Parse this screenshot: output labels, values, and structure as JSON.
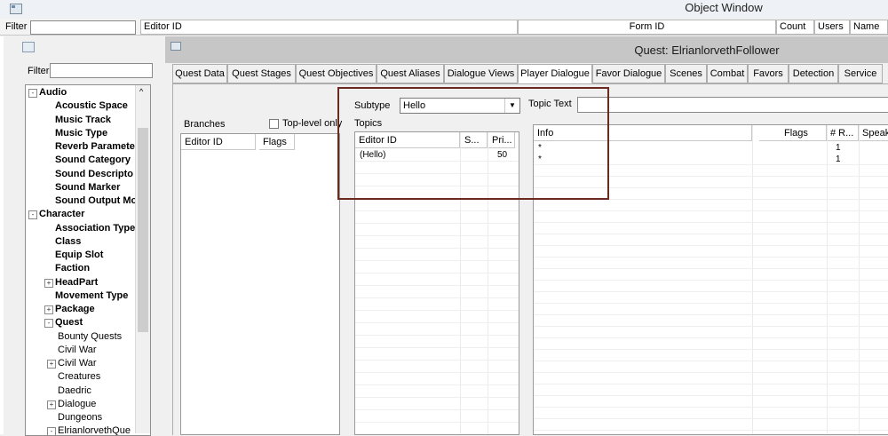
{
  "window": {
    "title": "Object Window"
  },
  "top_bar": {
    "filter_label": "Filter",
    "filter_value": "",
    "columns": [
      "Editor ID",
      "Form ID",
      "Count",
      "Users",
      "Name"
    ]
  },
  "left_pane": {
    "filter_label": "Filter",
    "filter_value": "",
    "tree": [
      {
        "label": "Audio",
        "level": 0,
        "bold": true,
        "expander": "-"
      },
      {
        "label": "Acoustic Space",
        "level": 1,
        "bold": true
      },
      {
        "label": "Music Track",
        "level": 1,
        "bold": true
      },
      {
        "label": "Music Type",
        "level": 1,
        "bold": true
      },
      {
        "label": "Reverb Paramete",
        "level": 1,
        "bold": true
      },
      {
        "label": "Sound Category",
        "level": 1,
        "bold": true
      },
      {
        "label": "Sound Descripto",
        "level": 1,
        "bold": true
      },
      {
        "label": "Sound Marker",
        "level": 1,
        "bold": true
      },
      {
        "label": "Sound Output Mo",
        "level": 1,
        "bold": true
      },
      {
        "label": "Character",
        "level": 0,
        "bold": true,
        "expander": "-"
      },
      {
        "label": "Association Type",
        "level": 1,
        "bold": true
      },
      {
        "label": "Class",
        "level": 1,
        "bold": true
      },
      {
        "label": "Equip Slot",
        "level": 1,
        "bold": true
      },
      {
        "label": "Faction",
        "level": 1,
        "bold": true
      },
      {
        "label": "HeadPart",
        "level": 1,
        "bold": true,
        "expander": "+"
      },
      {
        "label": "Movement Type",
        "level": 1,
        "bold": true
      },
      {
        "label": "Package",
        "level": 1,
        "bold": true,
        "expander": "+"
      },
      {
        "label": "Quest",
        "level": 1,
        "bold": true,
        "expander": "-"
      },
      {
        "label": "Bounty Quests",
        "level": 2,
        "bold": false
      },
      {
        "label": "Civil War",
        "level": 2,
        "bold": false
      },
      {
        "label": "Civil War",
        "level": 2,
        "bold": false,
        "expander": "+"
      },
      {
        "label": "Creatures",
        "level": 2,
        "bold": false
      },
      {
        "label": "Daedric",
        "level": 2,
        "bold": false
      },
      {
        "label": "Dialogue",
        "level": 2,
        "bold": false,
        "expander": "+"
      },
      {
        "label": "Dungeons",
        "level": 2,
        "bold": false
      },
      {
        "label": "ElrianlorvethQue",
        "level": 2,
        "bold": false,
        "expander": "-"
      }
    ]
  },
  "quest_window": {
    "title": "Quest: ElrianlorvethFollower",
    "tabs": [
      "Quest Data",
      "Quest Stages",
      "Quest Objectives",
      "Quest Aliases",
      "Dialogue Views",
      "Player Dialogue",
      "Favor Dialogue",
      "Scenes",
      "Combat",
      "Favors",
      "Detection",
      "Service"
    ],
    "active_tab": "Player Dialogue",
    "branches": {
      "label": "Branches",
      "top_level_only_label": "Top-level only",
      "columns": [
        "Editor ID",
        "Flags"
      ]
    },
    "subtype": {
      "label": "Subtype",
      "value": "Hello"
    },
    "topic_text": {
      "label": "Topic Text",
      "value": ""
    },
    "topics": {
      "label": "Topics",
      "columns": [
        "Editor ID",
        "S...",
        "Pri..."
      ],
      "rows": [
        {
          "editor_id": "(Hello)",
          "s": "",
          "pri": "50"
        }
      ]
    },
    "info": {
      "columns": [
        "Info",
        "Flags",
        "# R...",
        "Speak"
      ],
      "rows": [
        {
          "info": "*",
          "flags": "",
          "r": "1",
          "speak": ""
        },
        {
          "info": "*",
          "flags": "",
          "r": "1",
          "speak": ""
        }
      ]
    }
  },
  "colors": {
    "highlight_box": "#6b2a20",
    "tab_active": "#ffffff",
    "title_bar": "#c6c6c6"
  }
}
